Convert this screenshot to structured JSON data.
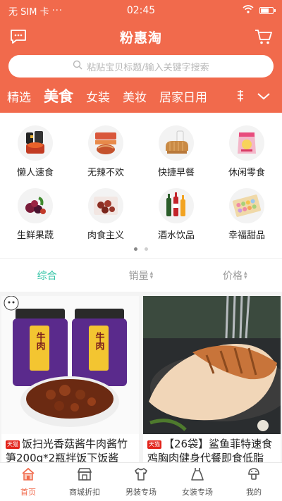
{
  "status_bar": {
    "carrier": "无 SIM 卡",
    "signal_dots": "···",
    "time": "02:45"
  },
  "app_bar": {
    "title": "粉惠淘"
  },
  "search": {
    "placeholder": "粘贴宝贝标题/输入关键字搜索"
  },
  "tabs": [
    {
      "label": "精选"
    },
    {
      "label": "美食",
      "active": true
    },
    {
      "label": "女装"
    },
    {
      "label": "美妆"
    },
    {
      "label": "居家日用"
    }
  ],
  "categories": [
    {
      "label": "懒人速食",
      "icon": "instant-food-icon"
    },
    {
      "label": "无辣不欢",
      "icon": "spicy-snack-icon"
    },
    {
      "label": "快捷早餐",
      "icon": "bread-milk-icon"
    },
    {
      "label": "休闲零食",
      "icon": "chips-bag-icon"
    },
    {
      "label": "生鲜果蔬",
      "icon": "fruit-icon"
    },
    {
      "label": "肉食主义",
      "icon": "meat-icon"
    },
    {
      "label": "酒水饮品",
      "icon": "bottles-icon"
    },
    {
      "label": "幸福甜品",
      "icon": "macaron-box-icon"
    }
  ],
  "category_pager": {
    "pages": 2,
    "current": 1
  },
  "sort_bar": [
    {
      "label": "综合",
      "active": true
    },
    {
      "label": "销量"
    },
    {
      "label": "价格"
    }
  ],
  "products": [
    {
      "badge": "天猫",
      "title": "饭扫光香菇酱牛肉酱竹笋200g*2瓶拌饭下饭酱",
      "jar_text": "牛肉"
    },
    {
      "badge": "天猫",
      "title": "【26袋】鲨鱼菲特速食鸡胸肉健身代餐即食低脂"
    }
  ],
  "bottom_nav": [
    {
      "label": "首页",
      "icon": "home-icon",
      "active": true
    },
    {
      "label": "商城折扣",
      "icon": "shop-icon"
    },
    {
      "label": "男装专场",
      "icon": "shirt-icon"
    },
    {
      "label": "女装专场",
      "icon": "dress-icon"
    },
    {
      "label": "我的",
      "icon": "user-icon"
    }
  ],
  "colors": {
    "brand": "#f16a4c",
    "accent": "#35c4a6"
  }
}
